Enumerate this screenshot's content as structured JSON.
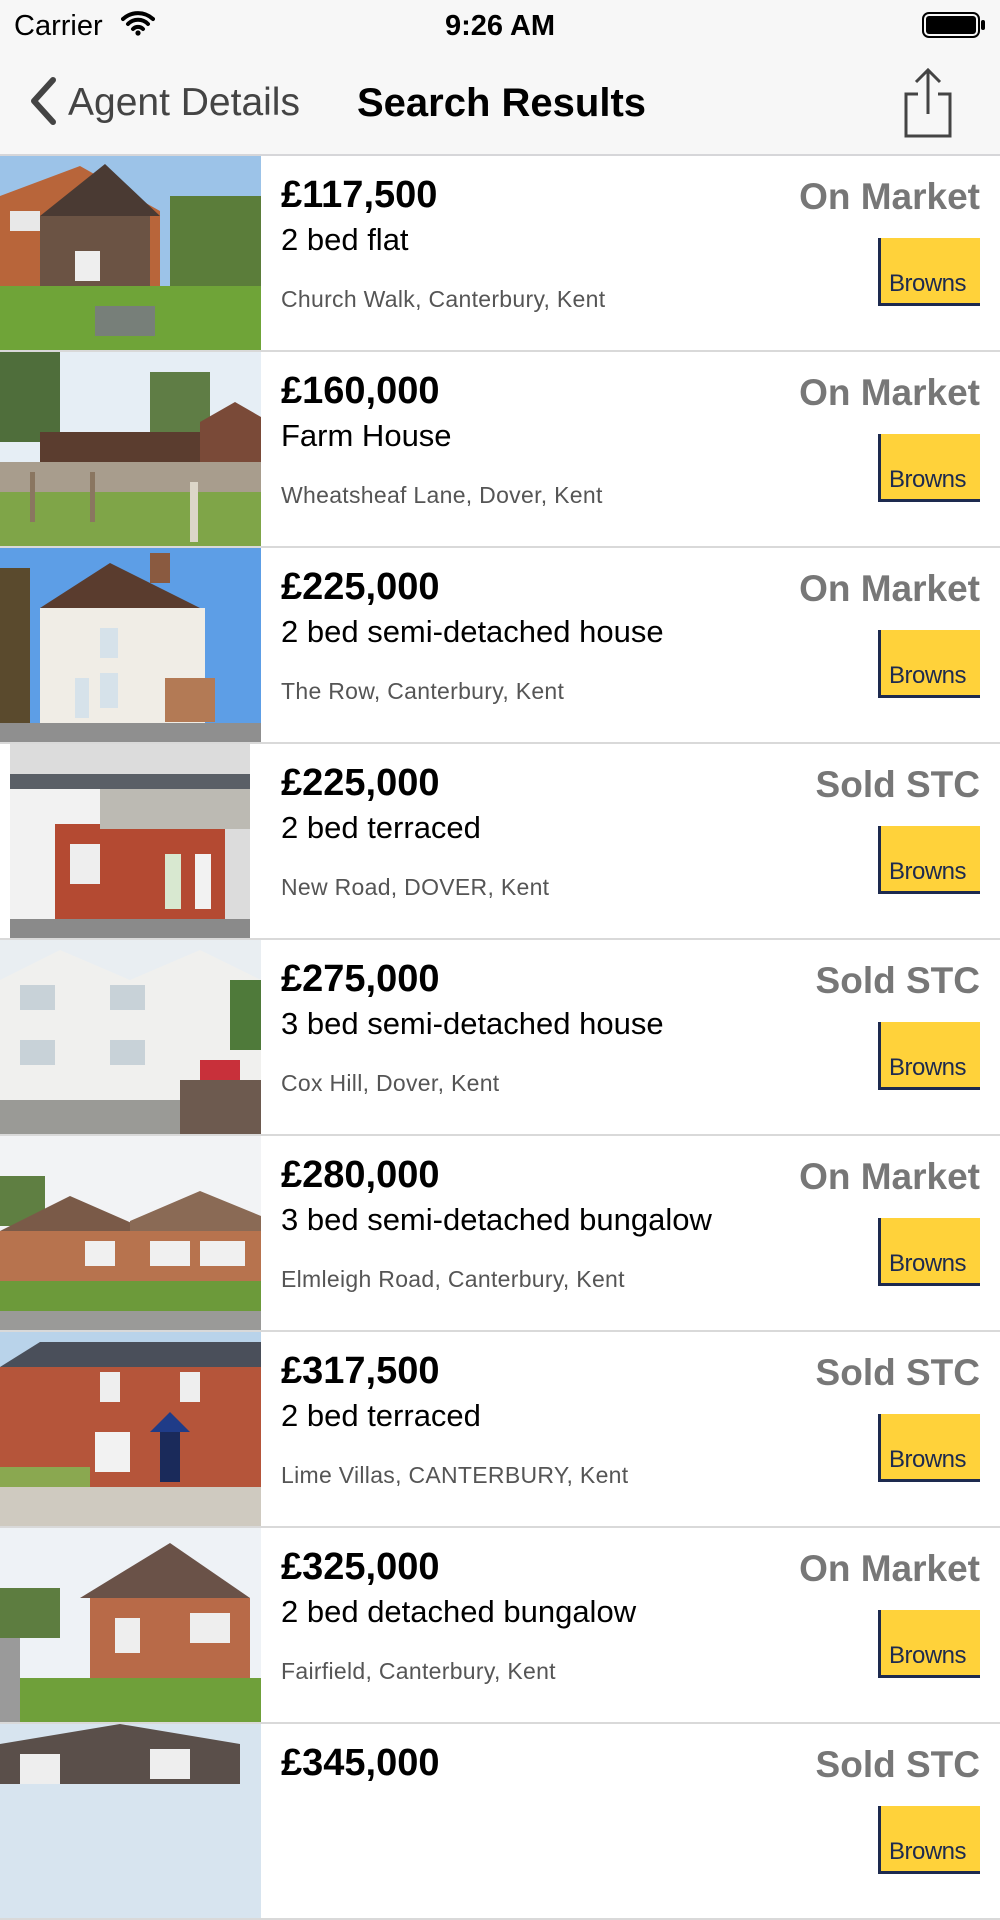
{
  "status_bar": {
    "carrier": "Carrier",
    "time": "9:26 AM"
  },
  "nav": {
    "back_label": "Agent Details",
    "title": "Search Results"
  },
  "agent_logo_text": "Browns",
  "colors": {
    "logo_yellow": "#ffd23a",
    "logo_navy": "#1d2a4f",
    "status_grey": "#777777"
  },
  "listings": [
    {
      "price": "£117,500",
      "type": "2 bed flat",
      "address": "Church Walk, Canterbury, Kent",
      "status": "On Market"
    },
    {
      "price": "£160,000",
      "type": "Farm House",
      "address": "Wheatsheaf Lane, Dover, Kent",
      "status": "On Market"
    },
    {
      "price": "£225,000",
      "type": "2 bed semi-detached house",
      "address": "The Row, Canterbury, Kent",
      "status": "On Market"
    },
    {
      "price": "£225,000",
      "type": "2 bed terraced",
      "address": "New Road, DOVER, Kent",
      "status": "Sold STC"
    },
    {
      "price": "£275,000",
      "type": "3 bed semi-detached house",
      "address": "Cox Hill, Dover, Kent",
      "status": "Sold STC"
    },
    {
      "price": "£280,000",
      "type": "3 bed semi-detached bungalow",
      "address": "Elmleigh Road, Canterbury, Kent",
      "status": "On Market"
    },
    {
      "price": "£317,500",
      "type": "2 bed terraced",
      "address": "Lime Villas, CANTERBURY, Kent",
      "status": "Sold STC"
    },
    {
      "price": "£325,000",
      "type": "2 bed detached bungalow",
      "address": "Fairfield, Canterbury, Kent",
      "status": "On Market"
    },
    {
      "price": "£345,000",
      "type": "",
      "address": "",
      "status": "Sold STC"
    }
  ]
}
